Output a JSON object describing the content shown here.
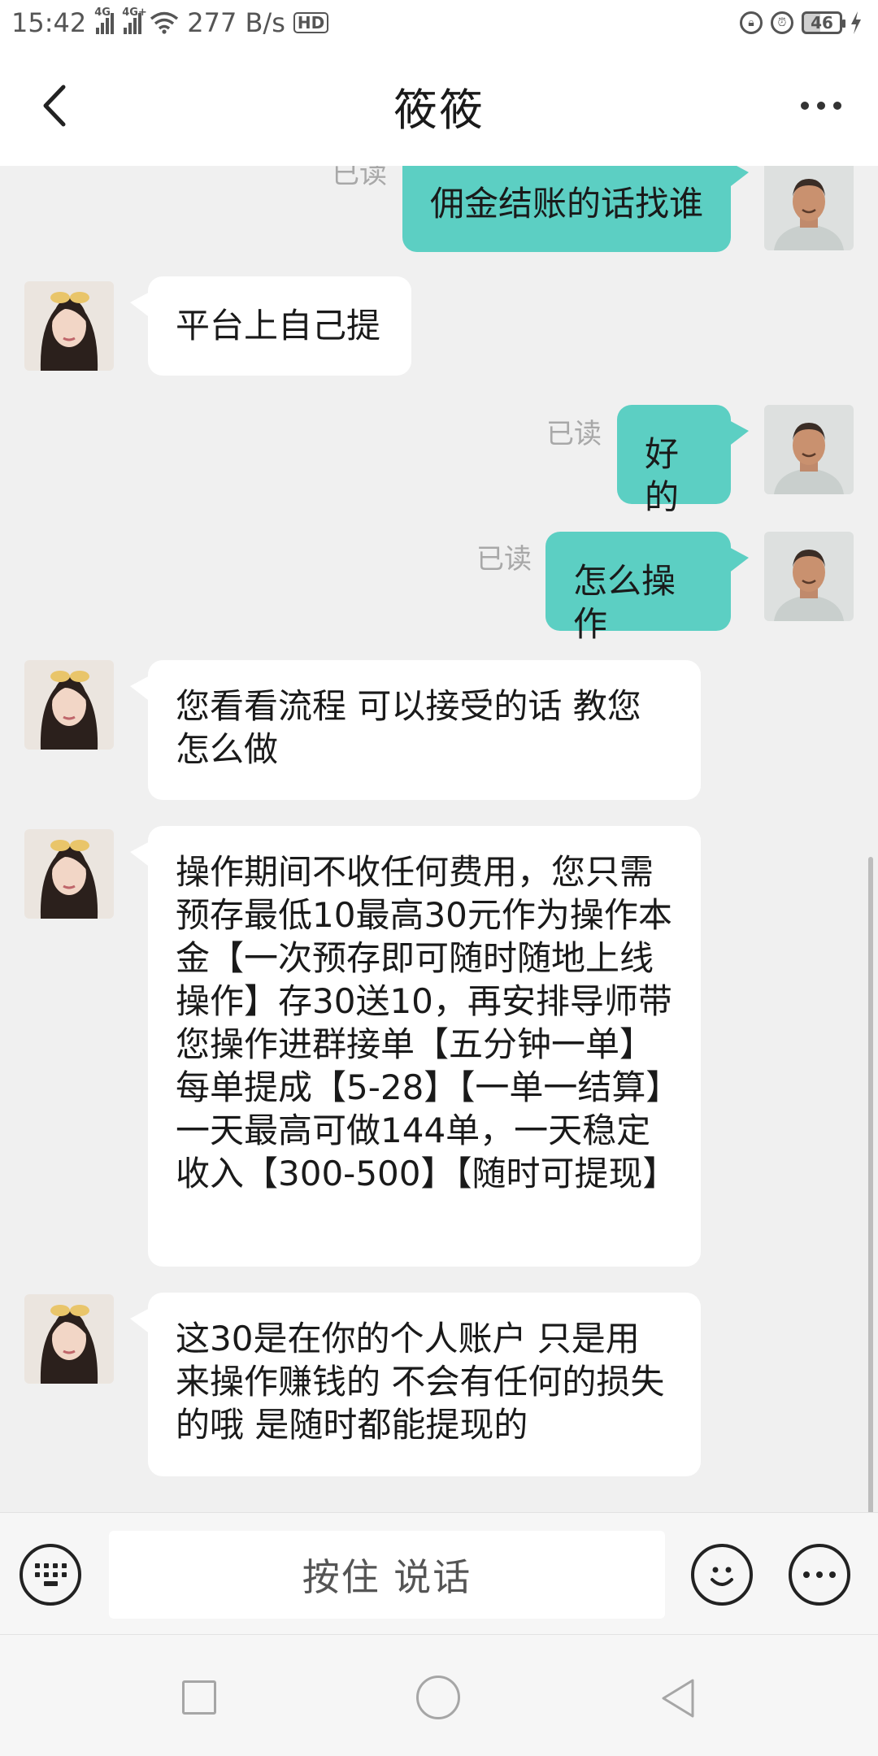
{
  "status_bar": {
    "time": "15:42",
    "net1": "4G",
    "net2": "4G+",
    "speed": "277 B/s",
    "hd": "HD",
    "battery": "46"
  },
  "header": {
    "title": "筱筱"
  },
  "chat": {
    "read_label": "已读",
    "messages": [
      {
        "sender": "self",
        "text": "佣金结账的话找谁",
        "read": true
      },
      {
        "sender": "contact",
        "text": "平台上自己提"
      },
      {
        "sender": "self",
        "text": "好的",
        "read": true
      },
      {
        "sender": "self",
        "text": "怎么操作",
        "read": true
      },
      {
        "sender": "contact",
        "text": "您看看流程 可以接受的话 教您怎么做"
      },
      {
        "sender": "contact",
        "text": "操作期间不收任何费用，您只需预存最低10最高30元作为操作本金【一次预存即可随时随地上线操作】存30送10，再安排导师带您操作进群接单【五分钟一单】每单提成【5-28】【一单一结算】一天最高可做144单，一天稳定收入【300-500】【随时可提现】"
      },
      {
        "sender": "contact",
        "text": "这30是在你的个人账户 只是用来操作赚钱的 不会有任何的损失的哦 是随时都能提现的"
      }
    ]
  },
  "input_bar": {
    "voice_label": "按住 说话"
  },
  "icons": {
    "back": "chevron-left-icon",
    "more": "more-horizontal-icon",
    "keyboard": "keyboard-icon",
    "emoji": "smiley-icon",
    "plus": "more-circle-icon",
    "nav_recent": "square-icon",
    "nav_home": "circle-icon",
    "nav_back": "triangle-back-icon"
  },
  "colors": {
    "outgoing_bubble": "#5ccfc3",
    "incoming_bubble": "#ffffff",
    "chat_background": "#f0f0f0"
  }
}
